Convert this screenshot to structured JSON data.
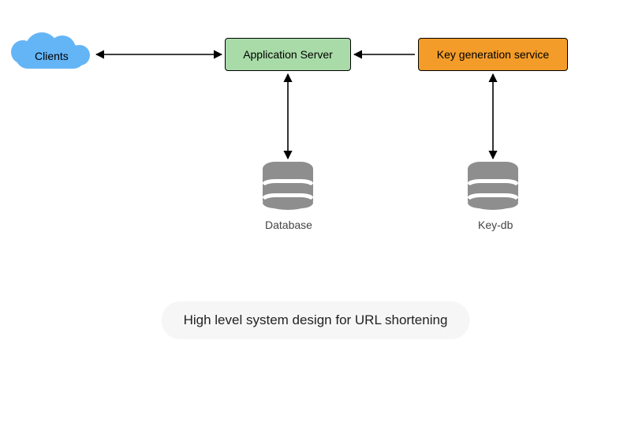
{
  "nodes": {
    "clients": {
      "label": "Clients"
    },
    "appserver": {
      "label": "Application Server"
    },
    "kgs": {
      "label": "Key generation service"
    },
    "database": {
      "label": "Database"
    },
    "keydb": {
      "label": "Key-db"
    }
  },
  "edges": [
    {
      "from": "clients",
      "to": "appserver",
      "bidirectional": true
    },
    {
      "from": "kgs",
      "to": "appserver",
      "bidirectional": false
    },
    {
      "from": "appserver",
      "to": "database",
      "bidirectional": true
    },
    {
      "from": "kgs",
      "to": "keydb",
      "bidirectional": true
    }
  ],
  "caption": "High level system design for URL shortening",
  "colors": {
    "cloud": "#64b5f6",
    "appserver": "#a8dba8",
    "kgs": "#f39c29",
    "db": "#8e8e8e"
  }
}
